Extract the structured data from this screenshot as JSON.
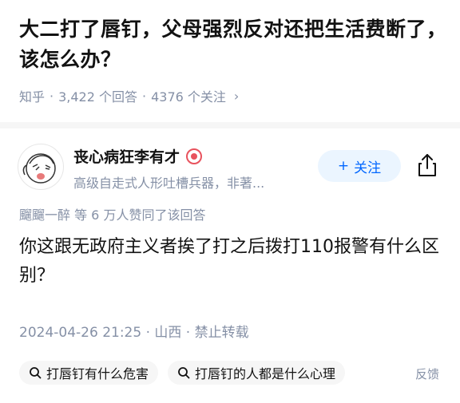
{
  "question": {
    "title": "大二打了唇钉，父母强烈反对还把生活费断了，该怎么办？",
    "source": "知乎",
    "answers_count": "3,422 个回答",
    "followers_count": "4376 个关注",
    "separator": "·"
  },
  "author": {
    "name": "丧心病狂李有才",
    "bio": "高级自走式人形吐槽兵器，非著...",
    "follow_label": "关注",
    "follow_plus": "+"
  },
  "answer": {
    "upvote_line": "飀飀一醉 等 6 万人赞同了该回答",
    "body": "你这跟无政府主义者挨了打之后拨打110报警有什么区别？",
    "meta": "2024-04-26 21:25 · 山西 · 禁止转载"
  },
  "related_searches": [
    {
      "label": "打唇钉有什么危害"
    },
    {
      "label": "打唇钉的人都是什么心理"
    }
  ],
  "feedback_label": "反馈",
  "colors": {
    "accent": "#0066ff",
    "muted": "#8590a6",
    "badge": "#e8525d"
  }
}
